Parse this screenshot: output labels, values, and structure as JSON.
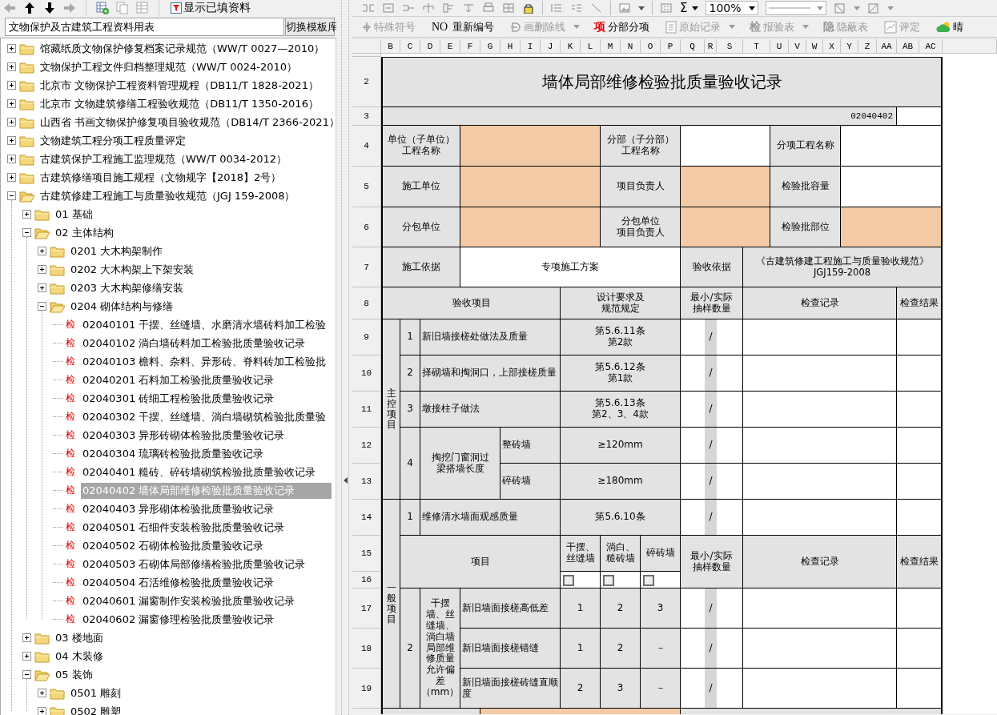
{
  "left_toolbar": {
    "tools": [
      {
        "kind": "left",
        "disabled": true
      },
      {
        "kind": "up",
        "disabled": false
      },
      {
        "kind": "down",
        "disabled": false
      },
      {
        "kind": "right",
        "disabled": true
      },
      {
        "kind": "add-table",
        "disabled": false
      },
      {
        "kind": "copy",
        "disabled": true
      },
      {
        "kind": "table",
        "disabled": true
      }
    ],
    "filter_button": {
      "label": "显示已填资料"
    }
  },
  "template_picker": {
    "value": "文物保护及古建筑工程资料用表",
    "button": "切换模板库"
  },
  "tree": [
    {
      "label": "馆藏纸质文物保护修复档案记录规范（WW/T 0027—2010）",
      "kind": "folder",
      "expanded": false,
      "selected": false
    },
    {
      "label": "文物保护工程文件归档整理规范（WW/T 0024-2010）",
      "kind": "folder",
      "expanded": false,
      "selected": false
    },
    {
      "label": "北京市 文物保护工程资料管理规程（DB11/T 1828-2021）",
      "kind": "folder",
      "expanded": false,
      "selected": false
    },
    {
      "label": "北京市 文物建筑修缮工程验收规范（DB11/T 1350-2016）",
      "kind": "folder",
      "expanded": false,
      "selected": false
    },
    {
      "label": "山西省 书画文物保护修复项目验收规范（DB14/T 2366-2021）",
      "kind": "folder",
      "expanded": false,
      "selected": false
    },
    {
      "label": "文物建筑工程分项工程质量评定",
      "kind": "folder",
      "expanded": false,
      "selected": false
    },
    {
      "label": "古建筑保护工程施工监理规范（WW/T 0034-2012）",
      "kind": "folder",
      "expanded": false,
      "selected": false
    },
    {
      "label": "古建筑修缮项目施工规程（文物规字【2018】2号）",
      "kind": "folder",
      "expanded": false,
      "selected": false
    },
    {
      "label": "古建筑修建工程施工与质量验收规范（JGJ 159-2008）",
      "kind": "folder",
      "expanded": true,
      "selected": false,
      "children": [
        {
          "label": "01 基础",
          "kind": "folder",
          "expanded": false,
          "selected": false
        },
        {
          "label": "02 主体结构",
          "kind": "folder",
          "expanded": true,
          "selected": false,
          "children": [
            {
              "label": "0201 大木构架制作",
              "kind": "folder",
              "expanded": false,
              "selected": false
            },
            {
              "label": "0202 大木构架上下架安装",
              "kind": "folder",
              "expanded": false,
              "selected": false
            },
            {
              "label": "0203 大木构架修缮安装",
              "kind": "folder",
              "expanded": false,
              "selected": false
            },
            {
              "label": "0204 砌体结构与修缮",
              "kind": "folder",
              "expanded": true,
              "selected": false,
              "children": [
                {
                  "label": "02040101 干摆、丝缝墙、水磨清水墙砖料加工检验",
                  "kind": "record",
                  "badge": "检",
                  "selected": false
                },
                {
                  "label": "02040102 淌白墙砖料加工检验批质量验收记录",
                  "kind": "record",
                  "badge": "检",
                  "selected": false
                },
                {
                  "label": "02040103 檐料、杂料、异形砖、脊料砖加工检验批",
                  "kind": "record",
                  "badge": "检",
                  "selected": false
                },
                {
                  "label": "02040201 石料加工检验批质量验收记录",
                  "kind": "record",
                  "badge": "检",
                  "selected": false
                },
                {
                  "label": "02040301 砖细工程检验批质量验收记录",
                  "kind": "record",
                  "badge": "检",
                  "selected": false
                },
                {
                  "label": "02040302 干摆、丝缝墙、淌白墙砌筑检验批质量验",
                  "kind": "record",
                  "badge": "检",
                  "selected": false
                },
                {
                  "label": "02040303 异形砖砌体检验批质量验收记录",
                  "kind": "record",
                  "badge": "检",
                  "selected": false
                },
                {
                  "label": "02040304 琉璃砖检验批质量验收记录",
                  "kind": "record",
                  "badge": "检",
                  "selected": false
                },
                {
                  "label": "02040401 糙砖、碎砖墙砌筑检验批质量验收记录",
                  "kind": "record",
                  "badge": "检",
                  "selected": false
                },
                {
                  "label": "02040402 墙体局部维修检验批质量验收记录",
                  "kind": "record",
                  "badge": "检",
                  "selected": true
                },
                {
                  "label": "02040403 异形砌体检验批质量验收记录",
                  "kind": "record",
                  "badge": "检",
                  "selected": false
                },
                {
                  "label": "02040501 石细件安装检验批质量验收记录",
                  "kind": "record",
                  "badge": "检",
                  "selected": false
                },
                {
                  "label": "02040502 石砌体检验批质量验收记录",
                  "kind": "record",
                  "badge": "检",
                  "selected": false
                },
                {
                  "label": "02040503 石砌体局部修缮检验批质量验收记录",
                  "kind": "record",
                  "badge": "检",
                  "selected": false
                },
                {
                  "label": "02040504 石活维修检验批质量验收记录",
                  "kind": "record",
                  "badge": "检",
                  "selected": false
                },
                {
                  "label": "02040601 漏窗制作安装检验批质量验收记录",
                  "kind": "record",
                  "badge": "检",
                  "selected": false
                },
                {
                  "label": "02040602 漏窗修理检验批质量验收记录",
                  "kind": "record",
                  "badge": "检",
                  "selected": false
                }
              ]
            }
          ]
        },
        {
          "label": "03 楼地面",
          "kind": "folder",
          "expanded": false,
          "selected": false
        },
        {
          "label": "04 木装修",
          "kind": "folder",
          "expanded": false,
          "selected": false
        },
        {
          "label": "05 装饰",
          "kind": "folder",
          "expanded": true,
          "selected": false,
          "children": [
            {
              "label": "0501 雕刻",
              "kind": "folder",
              "expanded": false,
              "selected": false
            },
            {
              "label": "0502 雕塑",
              "kind": "folder",
              "expanded": false,
              "selected": false
            }
          ]
        }
      ]
    }
  ],
  "format_toolbar": {
    "sum_glyph": "Σ",
    "zoom": "100%"
  },
  "form_toolbar": {
    "buttons": [
      {
        "kind": "plus-sign",
        "label": "特殊符号",
        "disabled": true,
        "dropdown": false
      },
      {
        "kind": "glyph",
        "glyph": "NO",
        "label": "重新编号",
        "disabled": false,
        "dropdown": false
      },
      {
        "kind": "strike",
        "label": "画删除线",
        "disabled": true,
        "dropdown": true
      },
      {
        "kind": "glyph-red",
        "glyph": "项",
        "label": "分部分项",
        "disabled": false,
        "dropdown": false
      },
      {
        "kind": "document",
        "label": "原始记录",
        "disabled": true,
        "dropdown": true
      },
      {
        "kind": "glyph",
        "glyph": "检",
        "label": "报验表",
        "disabled": true,
        "dropdown": true
      },
      {
        "kind": "glyph",
        "glyph": "隐",
        "label": "隐蔽表",
        "disabled": true,
        "dropdown": false
      },
      {
        "kind": "chart-doc",
        "label": "评定",
        "disabled": true,
        "dropdown": false
      },
      {
        "kind": "cloud",
        "label": "晴",
        "disabled": false,
        "dropdown": false
      }
    ]
  },
  "sheet": {
    "columns": [
      "B",
      "C",
      "D",
      "E",
      "F",
      "G",
      "H",
      "I",
      "J",
      "K",
      "L",
      "M",
      "N",
      "O",
      "P",
      "Q",
      "R",
      "S",
      "T",
      "U",
      "V",
      "W",
      "X",
      "Y",
      "Z",
      "AA",
      "AB",
      "AC"
    ],
    "row_numbers": [
      "2",
      "3",
      "4",
      "5",
      "6",
      "7",
      "8",
      "9",
      "10",
      "11",
      "12",
      "13",
      "14",
      "15",
      "16",
      "17",
      "18",
      "19"
    ],
    "cells": [
      {
        "kind": "title",
        "text": "墙体局部维修检验批质量验收记录"
      },
      {
        "kind": "code",
        "text": "02040402"
      },
      {
        "kind": "blank"
      },
      {
        "kind": "label",
        "lines": [
          "单位（子单位）",
          "工程名称"
        ]
      },
      {
        "kind": "fill"
      },
      {
        "kind": "label",
        "lines": [
          "分部（子分部）",
          "工程名称"
        ]
      },
      {
        "kind": "blank"
      },
      {
        "kind": "label",
        "text": "分项工程名称"
      },
      {
        "kind": "blank"
      },
      {
        "kind": "label",
        "text": "施工单位"
      },
      {
        "kind": "fill"
      },
      {
        "kind": "label",
        "text": "项目负责人"
      },
      {
        "kind": "fill"
      },
      {
        "kind": "label",
        "text": "检验批容量"
      },
      {
        "kind": "blank"
      },
      {
        "kind": "label",
        "text": "分包单位"
      },
      {
        "kind": "fill"
      },
      {
        "kind": "label",
        "lines": [
          "分包单位",
          "项目负责人"
        ]
      },
      {
        "kind": "fill"
      },
      {
        "kind": "label",
        "text": "检验批部位"
      },
      {
        "kind": "fill"
      },
      {
        "kind": "label",
        "text": "施工依据"
      },
      {
        "kind": "value",
        "text": "专项施工方案"
      },
      {
        "kind": "label",
        "text": "验收依据"
      },
      {
        "kind": "label",
        "lines": [
          "《古建筑修建工程施工与质量验收规范》",
          "JGJ159-2008"
        ]
      },
      {
        "kind": "label",
        "text": "验收项目"
      },
      {
        "kind": "label",
        "lines": [
          "设计要求及",
          "规范规定"
        ]
      },
      {
        "kind": "label",
        "lines": [
          "最小/实际",
          "抽样数量"
        ]
      },
      {
        "kind": "label",
        "text": "检查记录"
      },
      {
        "kind": "label",
        "text": "检查结果"
      },
      {
        "kind": "vlabel",
        "text": "主控项目"
      },
      {
        "kind": "label",
        "text": "1"
      },
      {
        "kind": "item",
        "text": "新旧墙接槎处做法及质量"
      },
      {
        "kind": "label",
        "lines": [
          "第5.6.11条",
          "第2款"
        ]
      },
      {
        "kind": "blank"
      },
      {
        "kind": "slash",
        "text": "/"
      },
      {
        "kind": "blank"
      },
      {
        "kind": "blank"
      },
      {
        "kind": "blank"
      },
      {
        "kind": "label",
        "text": "2"
      },
      {
        "kind": "item",
        "text": "择砌墙和掏洞口，上部接槎质量"
      },
      {
        "kind": "label",
        "lines": [
          "第5.6.12条",
          "第1款"
        ]
      },
      {
        "kind": "blank"
      },
      {
        "kind": "slash",
        "text": "/"
      },
      {
        "kind": "blank"
      },
      {
        "kind": "blank"
      },
      {
        "kind": "blank"
      },
      {
        "kind": "label",
        "text": "3"
      },
      {
        "kind": "item",
        "text": "墩接柱子做法"
      },
      {
        "kind": "label",
        "lines": [
          "第5.6.13条",
          "第2、3、4款"
        ]
      },
      {
        "kind": "blank"
      },
      {
        "kind": "slash",
        "text": "/"
      },
      {
        "kind": "blank"
      },
      {
        "kind": "blank"
      },
      {
        "kind": "blank"
      },
      {
        "kind": "label",
        "text": "4"
      },
      {
        "kind": "label",
        "lines": [
          "掏挖门窗洞过",
          "梁搭墙长度"
        ]
      },
      {
        "kind": "item",
        "text": "整砖墙"
      },
      {
        "kind": "label",
        "text": "≥120mm"
      },
      {
        "kind": "blank"
      },
      {
        "kind": "slash",
        "text": "/"
      },
      {
        "kind": "blank"
      },
      {
        "kind": "blank"
      },
      {
        "kind": "blank"
      },
      {
        "kind": "item",
        "text": "碎砖墙"
      },
      {
        "kind": "label",
        "text": "≥180mm"
      },
      {
        "kind": "blank"
      },
      {
        "kind": "slash",
        "text": "/"
      },
      {
        "kind": "blank"
      },
      {
        "kind": "blank"
      },
      {
        "kind": "blank"
      },
      {
        "kind": "vlabel",
        "text": "一般项目"
      },
      {
        "kind": "label",
        "text": "1"
      },
      {
        "kind": "item",
        "text": "维修清水墙面观感质量"
      },
      {
        "kind": "label",
        "text": "第5.6.10条"
      },
      {
        "kind": "blank"
      },
      {
        "kind": "slash",
        "text": "/"
      },
      {
        "kind": "blank"
      },
      {
        "kind": "blank"
      },
      {
        "kind": "blank"
      },
      {
        "kind": "label",
        "text": "项目"
      },
      {
        "kind": "label",
        "lines": [
          "干摆、",
          "丝缝墙"
        ]
      },
      {
        "kind": "label",
        "lines": [
          "淌白、",
          "糙砖墙"
        ]
      },
      {
        "kind": "label",
        "text": "碎砖墙"
      },
      {
        "kind": "label",
        "lines": [
          "最小/实际",
          "抽样数量"
        ]
      },
      {
        "kind": "label",
        "text": "检查记录"
      },
      {
        "kind": "label",
        "text": "检查结果"
      },
      {
        "kind": "check",
        "checked": false
      },
      {
        "kind": "check",
        "checked": false
      },
      {
        "kind": "check",
        "checked": false
      },
      {
        "kind": "label",
        "text": "2"
      },
      {
        "kind": "label",
        "text": "干摆墙、丝缝墙、淌白墙局部维修质量允许偏差（mm）"
      },
      {
        "kind": "item",
        "text": "新旧墙面接槎高低差"
      },
      {
        "kind": "label",
        "text": "1"
      },
      {
        "kind": "label",
        "text": "2"
      },
      {
        "kind": "label",
        "text": "3"
      },
      {
        "kind": "blank"
      },
      {
        "kind": "slash",
        "text": "/"
      },
      {
        "kind": "blank"
      },
      {
        "kind": "blank"
      },
      {
        "kind": "blank"
      },
      {
        "kind": "item",
        "text": "新旧墙面接槎错缝"
      },
      {
        "kind": "label",
        "text": "1"
      },
      {
        "kind": "label",
        "text": "2"
      },
      {
        "kind": "label",
        "text": "－"
      },
      {
        "kind": "blank"
      },
      {
        "kind": "slash",
        "text": "/"
      },
      {
        "kind": "blank"
      },
      {
        "kind": "blank"
      },
      {
        "kind": "blank"
      },
      {
        "kind": "item",
        "text": "新旧墙面接槎砖缝直顺度"
      },
      {
        "kind": "label",
        "text": "2"
      },
      {
        "kind": "label",
        "text": "3"
      },
      {
        "kind": "label",
        "text": "－"
      },
      {
        "kind": "blank"
      },
      {
        "kind": "slash",
        "text": "/"
      },
      {
        "kind": "blank"
      },
      {
        "kind": "blank"
      },
      {
        "kind": "blank"
      },
      {
        "kind": "shade"
      },
      {
        "kind": "fill"
      },
      {
        "kind": "shade"
      }
    ]
  }
}
